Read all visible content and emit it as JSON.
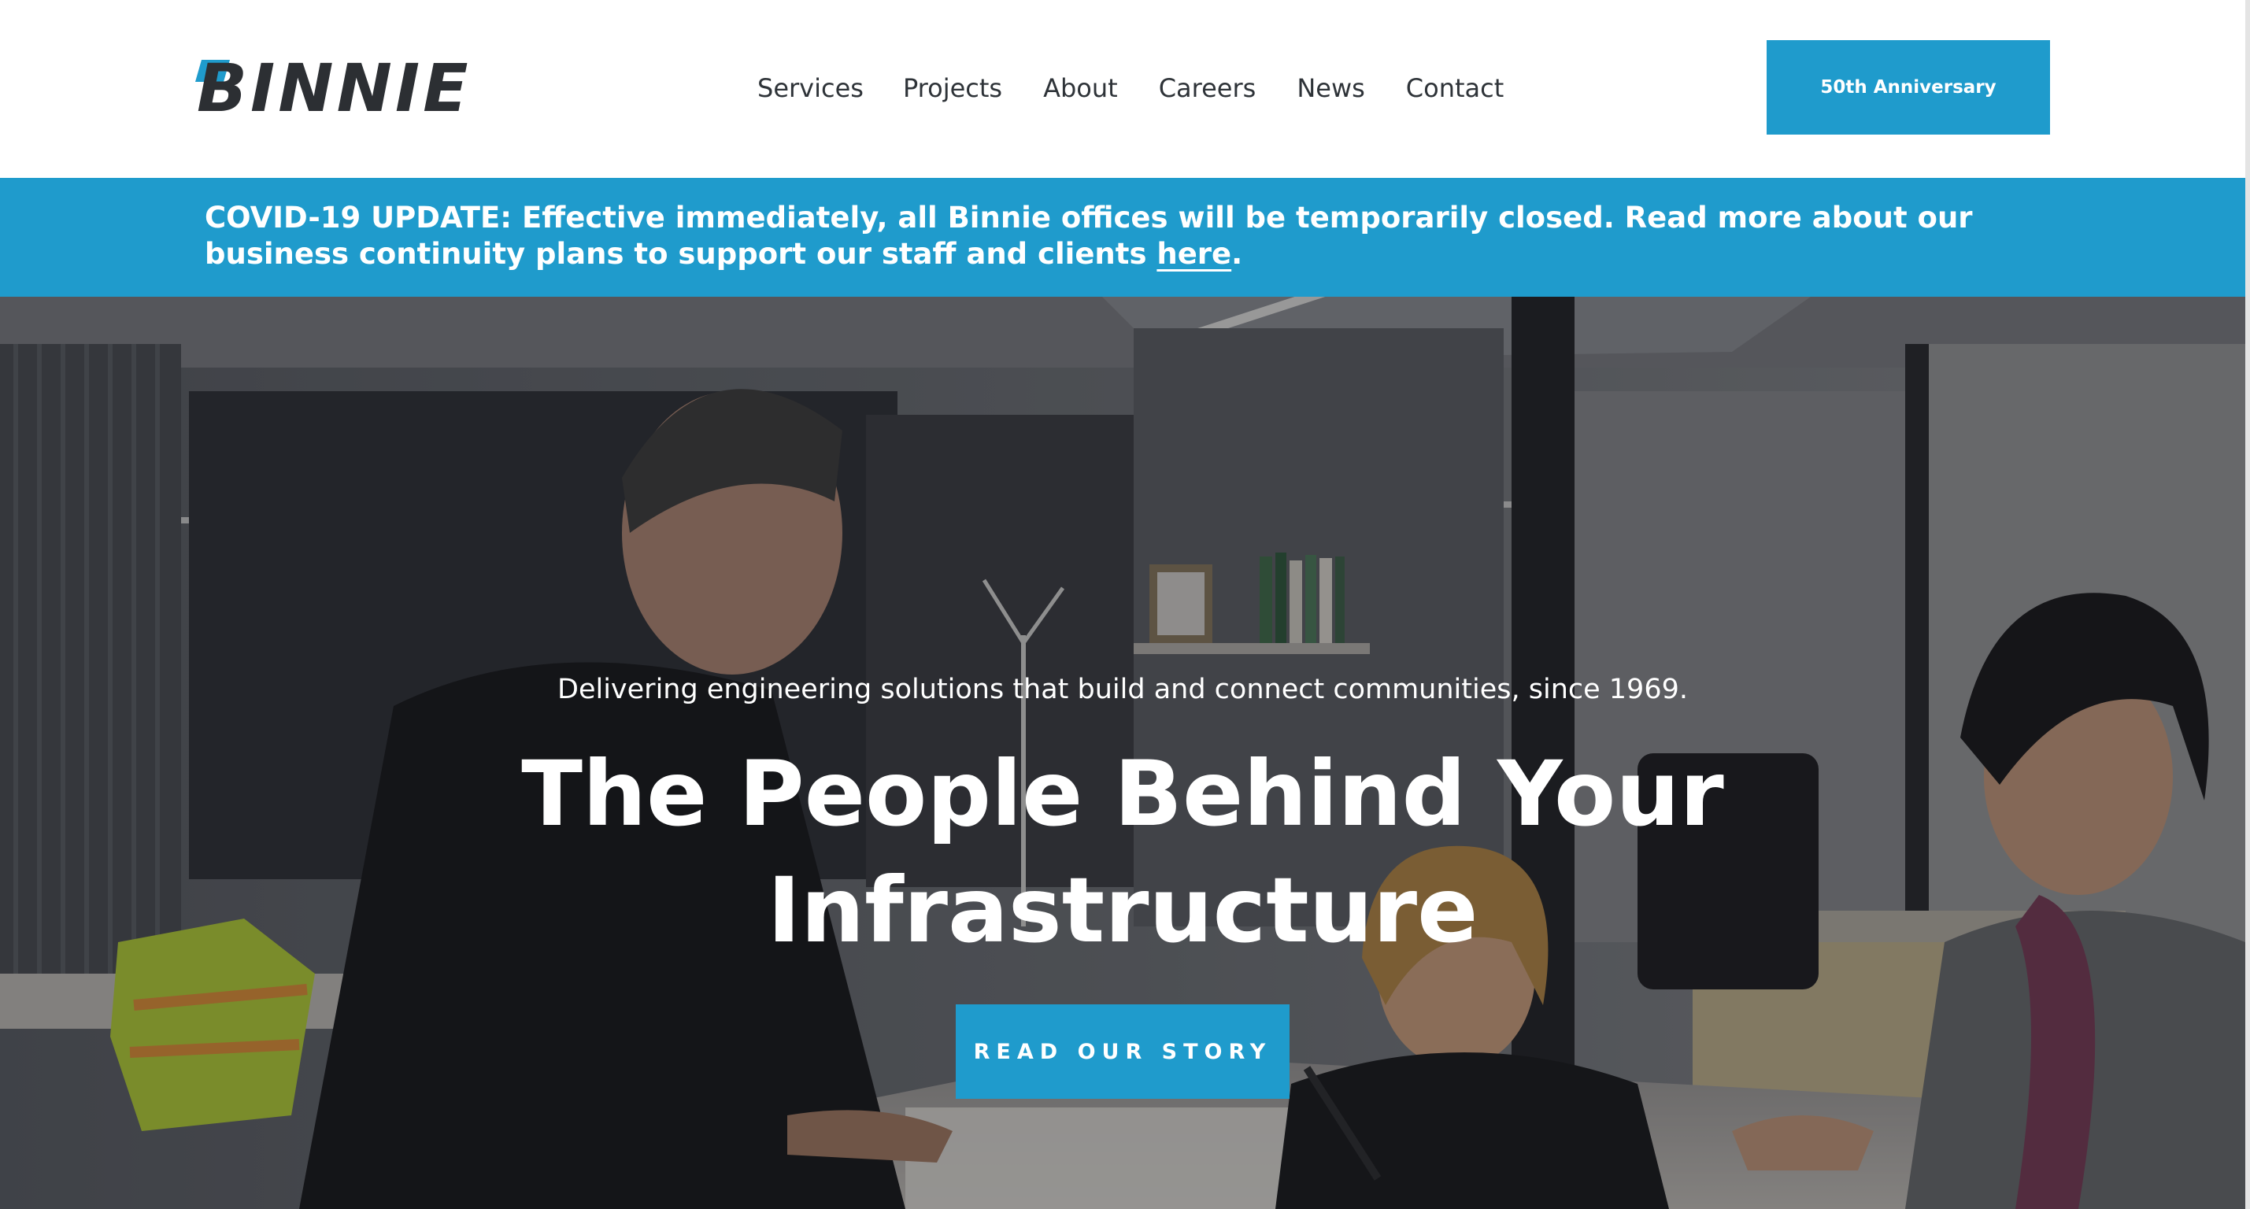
{
  "header": {
    "logo_text": "BINNIE",
    "nav": [
      {
        "label": "Services"
      },
      {
        "label": "Projects"
      },
      {
        "label": "About"
      },
      {
        "label": "Careers"
      },
      {
        "label": "News"
      },
      {
        "label": "Contact"
      }
    ],
    "anniversary_button": "50th Anniversary"
  },
  "alert": {
    "text": "COVID-19 UPDATE: Effective immediately, all Binnie offices will be temporarily closed. Read more about our business continuity plans to support our staff and clients ",
    "link_text": "here",
    "suffix": "."
  },
  "hero": {
    "tagline": "Delivering engineering solutions that build and connect communities, since 1969.",
    "title": "The People Behind Your Infrastructure",
    "cta": "READ OUR STORY"
  },
  "colors": {
    "brand_blue": "#1f9bcc",
    "logo_dark": "#2c2f33",
    "nav_text": "#2e3338"
  }
}
